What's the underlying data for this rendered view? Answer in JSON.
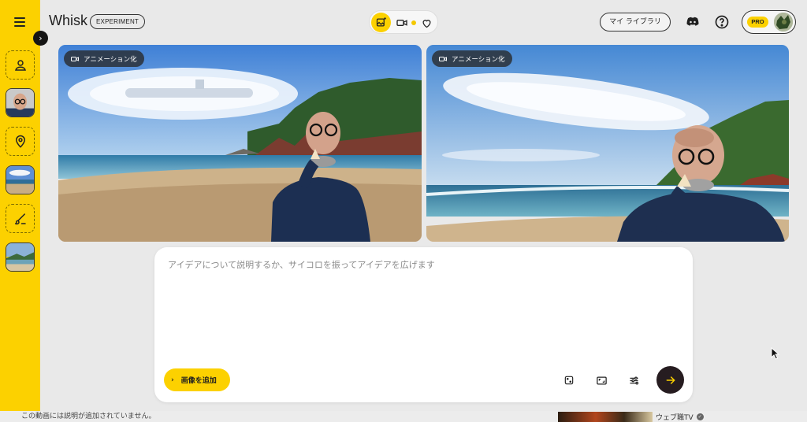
{
  "header": {
    "logo": "Whisk",
    "badge": "EXPERIMENT",
    "library_label": "マイ ライブラリ",
    "pro_label": "PRO"
  },
  "cards": [
    {
      "chip_label": "アニメーション化"
    },
    {
      "chip_label": "アニメーション化"
    }
  ],
  "prompt": {
    "placeholder": "アイデアについて説明するか、サイコロを振ってアイデアを広げます",
    "add_image_label": "画像を追加"
  },
  "footer": {
    "description_note": "この動画には説明が追加されていません。",
    "channel_name": "ウェブ職TV"
  },
  "colors": {
    "accent": "#fcd100",
    "send_button": "#261c20"
  },
  "icons": {
    "sidebar": [
      "menu-icon",
      "person-icon",
      "location-pin-icon",
      "brush-icon"
    ],
    "toolbar": [
      "dice-icon",
      "aspect-ratio-icon",
      "sliders-icon",
      "arrow-right-icon"
    ]
  }
}
